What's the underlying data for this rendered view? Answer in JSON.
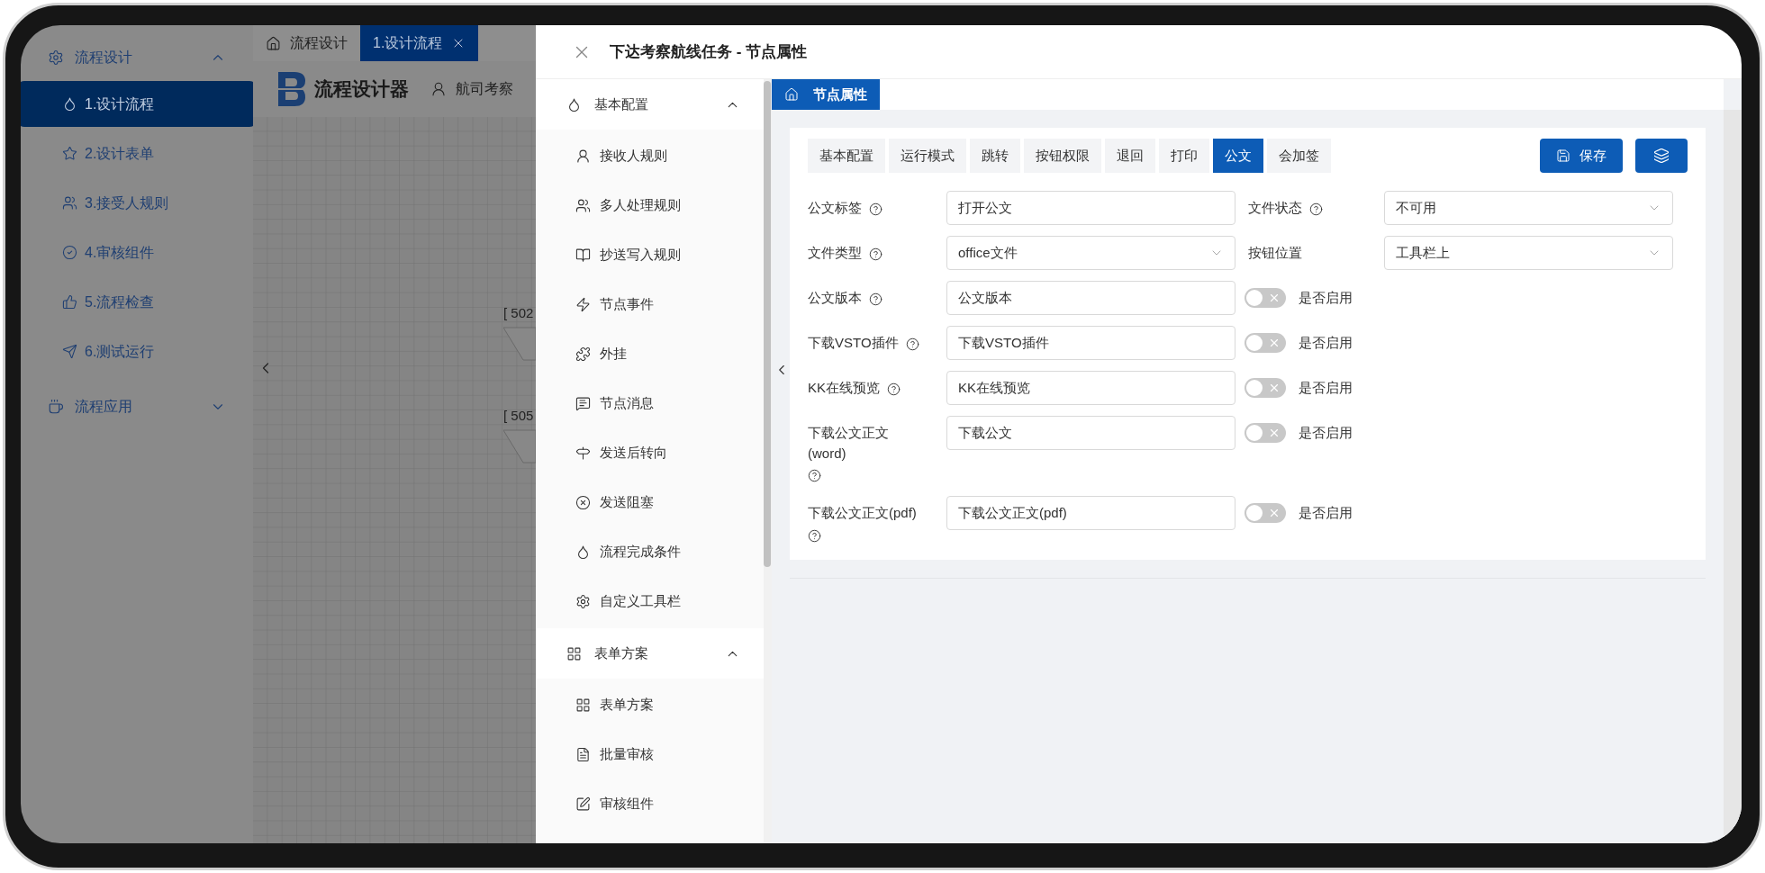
{
  "sidebar": {
    "groups": [
      {
        "label": "流程设计",
        "expanded": true,
        "items": [
          {
            "label": "1.设计流程",
            "selected": true
          },
          {
            "label": "2.设计表单",
            "selected": false
          },
          {
            "label": "3.接受人规则",
            "selected": false
          },
          {
            "label": "4.审核组件",
            "selected": false
          },
          {
            "label": "5.流程检查",
            "selected": false
          },
          {
            "label": "6.测试运行",
            "selected": false
          }
        ]
      },
      {
        "label": "流程应用",
        "expanded": false
      }
    ]
  },
  "tabs": [
    {
      "kind": "home",
      "label": "流程设计",
      "selected": false
    },
    {
      "kind": "closable",
      "label": "1.设计流程",
      "selected": true
    }
  ],
  "header": {
    "title": "流程设计器",
    "user": "航司考察"
  },
  "canvas": {
    "nodes": [
      {
        "label": "[ 502"
      },
      {
        "label": "[ 505"
      }
    ]
  },
  "drawer": {
    "title": "下达考察航线任务 - 节点属性",
    "menu": [
      {
        "label": "基本配置",
        "expanded": true,
        "items": [
          "接收人规则",
          "多人处理规则",
          "抄送写入规则",
          "节点事件",
          "外挂",
          "节点消息",
          "发送后转向",
          "发送阻塞",
          "流程完成条件",
          "自定义工具栏"
        ]
      },
      {
        "label": "表单方案",
        "expanded": true,
        "items": [
          "表单方案",
          "批量审核",
          "审核组件"
        ]
      }
    ],
    "page_tab": "节点属性",
    "tabs": [
      {
        "label": "基本配置",
        "selected": false
      },
      {
        "label": "运行模式",
        "selected": false
      },
      {
        "label": "跳转",
        "selected": false
      },
      {
        "label": "按钮权限",
        "selected": false
      },
      {
        "label": "退回",
        "selected": false
      },
      {
        "label": "打印",
        "selected": false
      },
      {
        "label": "公文",
        "selected": true
      },
      {
        "label": "会加签",
        "selected": false
      }
    ],
    "save_label": "保存",
    "rows": [
      {
        "fields": [
          {
            "kind": "input",
            "label": "公文标签",
            "help": true,
            "value": "打开公文"
          },
          {
            "kind": "select",
            "label": "文件状态",
            "help": true,
            "value": "不可用"
          }
        ]
      },
      {
        "fields": [
          {
            "kind": "select",
            "label": "文件类型",
            "help": true,
            "value": "office文件"
          },
          {
            "kind": "select",
            "label": "按钮位置",
            "help": false,
            "value": "工具栏上"
          }
        ]
      },
      {
        "fields": [
          {
            "kind": "input",
            "label": "公文版本",
            "help": true,
            "value": "公文版本"
          },
          {
            "kind": "switch",
            "on": false,
            "label": "是否启用"
          }
        ]
      },
      {
        "fields": [
          {
            "kind": "input",
            "label": "下载VSTO插件",
            "help": true,
            "value": "下载VSTO插件"
          },
          {
            "kind": "switch",
            "on": false,
            "label": "是否启用"
          }
        ]
      },
      {
        "fields": [
          {
            "kind": "input",
            "label": "KK在线预览",
            "help": true,
            "value": "KK在线预览"
          },
          {
            "kind": "switch",
            "on": false,
            "label": "是否启用"
          }
        ]
      },
      {
        "fields": [
          {
            "kind": "input",
            "label": "下载公文正文(word)",
            "help": true,
            "value": "下载公文"
          },
          {
            "kind": "switch",
            "on": false,
            "label": "是否启用"
          }
        ]
      },
      {
        "fields": [
          {
            "kind": "input",
            "label": "下载公文正文(pdf)",
            "help": true,
            "value": "下载公文正文(pdf)"
          },
          {
            "kind": "switch",
            "on": false,
            "label": "是否启用"
          }
        ]
      }
    ]
  }
}
